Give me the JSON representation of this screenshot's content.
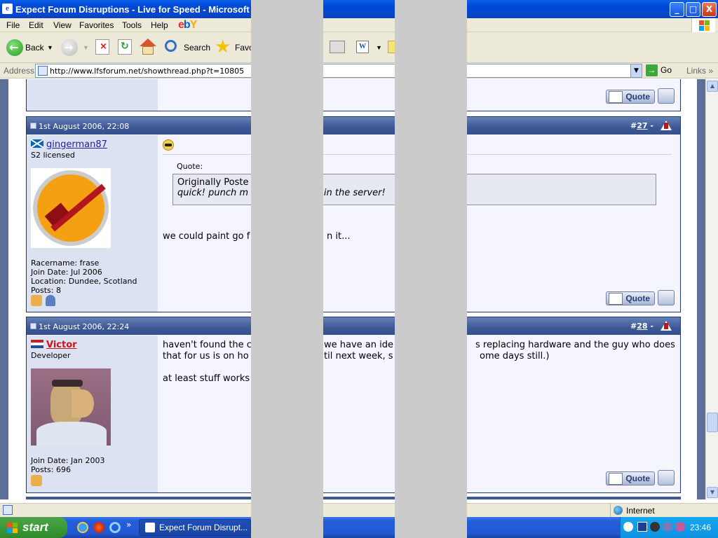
{
  "window": {
    "title": "Expect Forum Disruptions - Live for Speed - Microsoft I",
    "min_label": "_",
    "max_label": "□",
    "close_label": "X"
  },
  "menu": {
    "items": [
      "File",
      "Edit",
      "View",
      "Favorites",
      "Tools",
      "Help"
    ],
    "ebay": "ebY"
  },
  "toolbar": {
    "back": "Back",
    "search": "Search",
    "favorites": "Favo"
  },
  "address": {
    "label": "Address",
    "url": "http://www.lfsforum.net/showthread.php?t=10805",
    "go": "Go",
    "links": "Links"
  },
  "posts": [
    {
      "date": "1st August 2006, 22:08",
      "hash": "#",
      "number": "27",
      "sep": "-",
      "username": "gingerman87",
      "usertitle": "S2 licensed",
      "racername": "Racername: frase",
      "join": "Join Date: Jul 2006",
      "location": "Location: Dundee, Scotland",
      "posts": "Posts: 8",
      "quote_label": "Quote:",
      "quote_author": "Originally Poste",
      "quote_text_a": "quick! punch m",
      "quote_text_b": "s in the server!",
      "body_a": "we could paint go f",
      "body_b": "n it...",
      "quote_button": "Quote"
    },
    {
      "date": "1st August 2006, 22:24",
      "hash": "#",
      "number": "28",
      "sep": "-",
      "username": "Victor",
      "usertitle": "Developer",
      "join": "Join Date: Jan 2003",
      "posts": "Posts: 696",
      "body_line1_a": "haven't found the c",
      "body_line1_b": "we have an ide",
      "body_line1_c": "s replacing hardware and the guy who does",
      "body_line2_a": "that for us is on ho",
      "body_line2_b": "til next week, s",
      "body_line2_c": "ome days still.)",
      "body_line3": "at least stuff works",
      "quote_button": "Quote"
    }
  ],
  "top_quote_button": "Quote",
  "status": {
    "zone": "Internet"
  },
  "taskbar": {
    "start": "start",
    "task": "Expect Forum Disrupt...",
    "clock": "23:46",
    "chevron": "»"
  },
  "colors": {
    "post_header": "#3d5895",
    "left_panel": "#dde2f2",
    "taskbar": "#245edb",
    "start_green": "#3b9b38"
  }
}
